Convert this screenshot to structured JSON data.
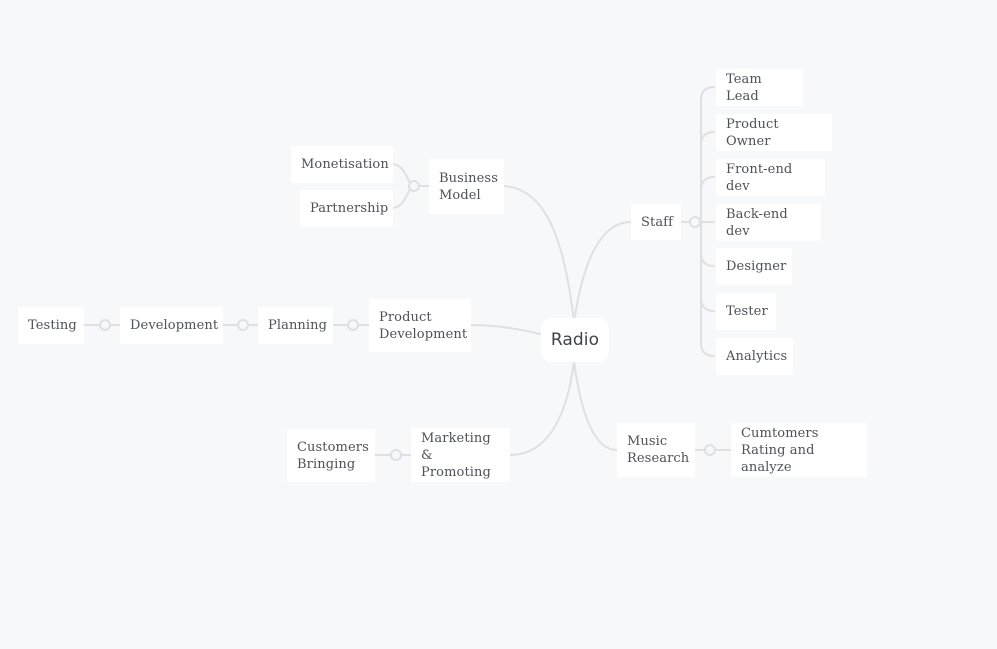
{
  "canvas": {
    "background": "#f7f8fa",
    "line_color": "#dde0e4",
    "node_background": "#ffffff",
    "text_color": "#4e5156"
  },
  "root": {
    "label": "Radio"
  },
  "branches": {
    "business_model": {
      "label": "Business\nModel",
      "children": {
        "monetisation": "Monetisation",
        "partnership": "Partnership"
      }
    },
    "product_development": {
      "label": "Product\nDevelopment",
      "chain": {
        "planning": "Planning",
        "development": "Development",
        "testing": "Testing"
      }
    },
    "marketing": {
      "label": "Marketing\n& Promoting",
      "children": {
        "customers_bringing": "Customers\nBringing"
      }
    },
    "staff": {
      "label": "Staff",
      "children": {
        "team_lead": "Team Lead",
        "product_owner": "Product Owner",
        "frontend_dev": "Front-end dev",
        "backend_dev": "Back-end dev",
        "designer": "Designer",
        "tester": "Tester",
        "analytics": "Analytics"
      }
    },
    "music_research": {
      "label": "Music\nResearch",
      "children": {
        "customers_rating": "Cumtomers\nRating and analyze"
      }
    }
  }
}
